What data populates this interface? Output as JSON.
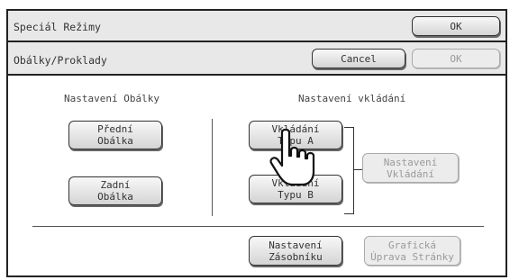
{
  "header": {
    "title": "Speciál Režimy",
    "ok_label": "OK"
  },
  "subheader": {
    "title": "Obálky/Proklady",
    "cancel_label": "Cancel",
    "ok_label": "OK"
  },
  "cover": {
    "heading": "Nastavení Obálky",
    "front": [
      "Přední",
      "Obálka"
    ],
    "back": [
      "Zadní",
      "Obálka"
    ]
  },
  "insert": {
    "heading": "Nastavení vkládání",
    "type_a": [
      "Vkládání",
      "Typu A"
    ],
    "type_b": [
      "Vkládání",
      "Typu B"
    ],
    "settings": [
      "Nastavení",
      "Vkládání"
    ]
  },
  "bottom": {
    "tray": [
      "Nastavení",
      "Zásobníku"
    ],
    "graphic": [
      "Grafická",
      "Úprava Stránky"
    ]
  }
}
